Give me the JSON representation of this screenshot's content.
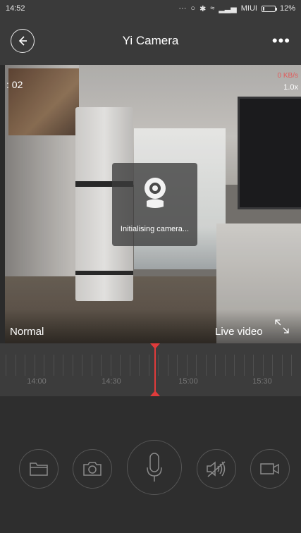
{
  "status_bar": {
    "time": "14:52",
    "carrier": "MIUI",
    "battery": "12%",
    "battery_level": 0.12
  },
  "app_bar": {
    "title": "Yi Camera",
    "back_icon": "back-arrow-icon",
    "menu_icon": "more-dots-icon"
  },
  "video": {
    "time_readout": ": 02",
    "bitrate": "0 KB/s",
    "zoom": "1.0x",
    "status_text": "Initialising camera...",
    "mode": "Normal",
    "live_label": "Live video",
    "expand_icon": "fullscreen-expand-icon"
  },
  "timeline": {
    "labels": [
      "14:00",
      "14:30",
      "15:00",
      "15:30"
    ],
    "playhead_color": "#e03b3b"
  },
  "controls": [
    {
      "name": "folder-button",
      "icon": "folder-icon"
    },
    {
      "name": "snapshot-button",
      "icon": "camera-icon"
    },
    {
      "name": "microphone-button",
      "icon": "microphone-icon"
    },
    {
      "name": "mute-button",
      "icon": "speaker-muted-icon"
    },
    {
      "name": "record-button",
      "icon": "video-record-icon"
    }
  ],
  "colors": {
    "accent": "#e03b3b",
    "background": "#2b2b2b",
    "bar": "#3a3a3a"
  }
}
